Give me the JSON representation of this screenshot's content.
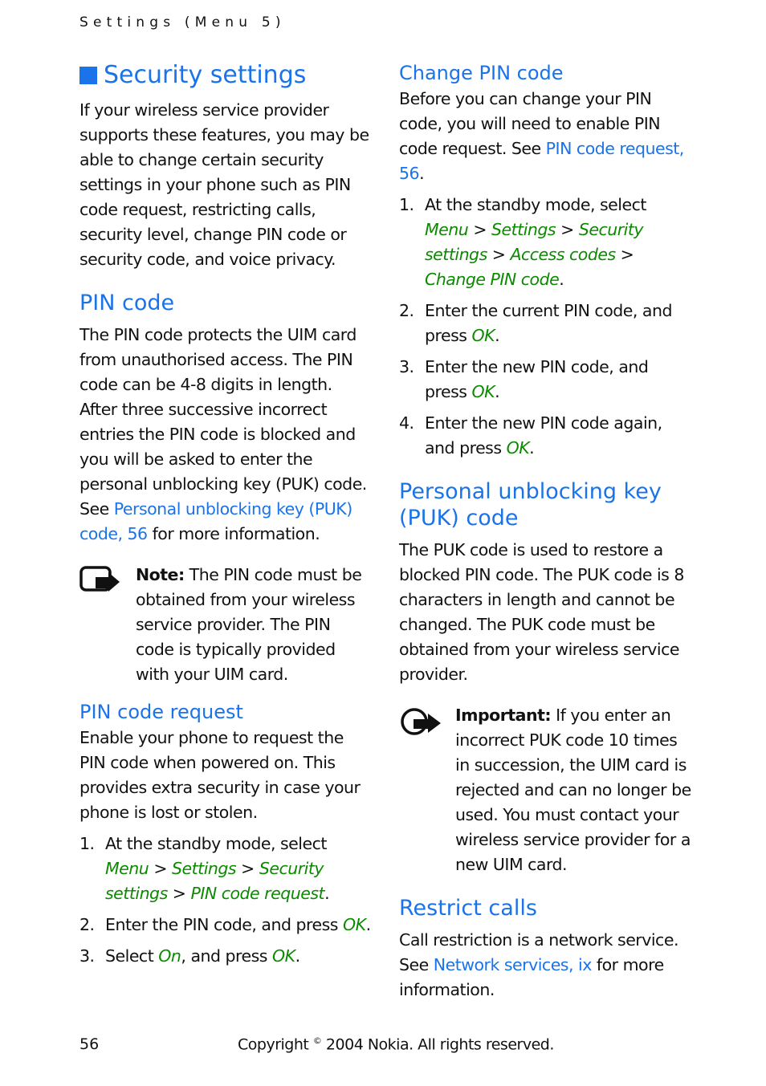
{
  "header": {
    "running_title": "Settings (Menu 5)"
  },
  "left": {
    "title": "Security settings",
    "intro": "If your wireless service provider supports these features, you may be able to change certain security settings in your phone such as PIN code request, restricting calls, security level, change PIN code or security code, and voice privacy.",
    "pin_code": {
      "heading": "PIN code",
      "body": "The PIN code protects the UIM card from unauthorised access. The PIN code can be 4-8 digits in length. After three successive incorrect entries the PIN code is blocked and you will be asked to enter the personal unblocking key (PUK) code. See ",
      "link": "Personal unblocking key (PUK) code, 56",
      "body_after": " for more information."
    },
    "note": {
      "icon": "note-icon",
      "label": "Note:",
      "text": " The PIN code must be obtained from your wireless service provider. The PIN code is typically provided with your UIM card."
    },
    "pin_request": {
      "heading": "PIN code request",
      "body": "Enable your phone to request the PIN code when powered on. This provides extra security in case your phone is lost or stolen.",
      "steps": [
        {
          "num": "1.",
          "pre": "At the standby mode, select ",
          "path": [
            "Menu",
            "Settings",
            "Security settings",
            "PIN code request"
          ],
          "post": "."
        },
        {
          "num": "2.",
          "pre": "Enter the PIN code, and press ",
          "ui": "OK",
          "post": "."
        },
        {
          "num": "3.",
          "pre": "Select ",
          "ui": "On",
          "mid": ", and press ",
          "ui2": "OK",
          "post": "."
        }
      ]
    }
  },
  "right": {
    "change_pin": {
      "heading": "Change PIN code",
      "body": "Before you can change your PIN code, you will need to enable PIN code request. See ",
      "link": "PIN code request, 56",
      "body_after": ".",
      "steps": [
        {
          "num": "1.",
          "pre": "At the standby mode, select ",
          "path": [
            "Menu",
            "Settings",
            "Security settings",
            "Access codes",
            "Change PIN code"
          ],
          "post": "."
        },
        {
          "num": "2.",
          "pre": "Enter the current PIN code, and press ",
          "ui": "OK",
          "post": "."
        },
        {
          "num": "3.",
          "pre": "Enter the new PIN code, and press ",
          "ui": "OK",
          "post": "."
        },
        {
          "num": "4.",
          "pre": "Enter the new PIN code again, and press ",
          "ui": "OK",
          "post": "."
        }
      ]
    },
    "puk": {
      "heading": "Personal unblocking key (PUK) code",
      "body": "The PUK code is used to restore a blocked PIN code. The PUK code is 8 characters in length and cannot be changed. The PUK code must be obtained from your wireless service provider."
    },
    "important": {
      "icon": "important-icon",
      "label": "Important:",
      "text": " If you enter an incorrect PUK code 10 times in succession, the UIM card is rejected and can no longer be used. You must contact your wireless service provider for a new UIM card."
    },
    "restrict": {
      "heading": "Restrict calls",
      "body": "Call restriction is a network service. See ",
      "link": "Network services, ix",
      "body_after": " for more information."
    }
  },
  "footer": {
    "page_number": "56",
    "copyright_pre": "Copyright ",
    "copyright_symbol": "©",
    "copyright_post": " 2004 Nokia. All rights reserved."
  }
}
